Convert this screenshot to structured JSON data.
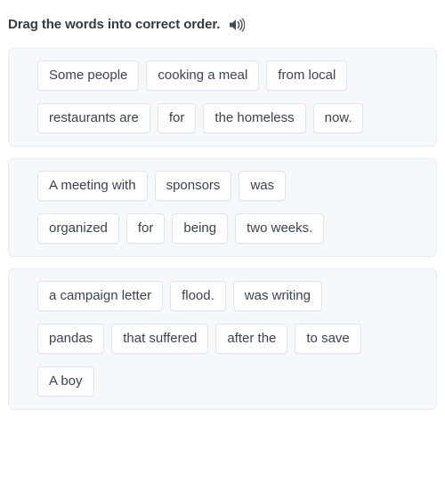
{
  "header": {
    "title": "Drag the words into correct order.",
    "audio_icon": "speaker-icon"
  },
  "colors": {
    "card_background": "#f5f9fc",
    "card_border": "#e7ecf1",
    "chip_background": "#ffffff",
    "chip_border": "#dfe5ea",
    "chip_text": "#3b4450",
    "title_text": "#333b45",
    "page_background": "#ffffff"
  },
  "exercises": [
    {
      "rows": [
        [
          "Some people",
          "cooking a meal",
          "from local"
        ],
        [
          "restaurants are",
          "for",
          "the homeless",
          "now."
        ]
      ]
    },
    {
      "rows": [
        [
          "A meeting with",
          "sponsors",
          "was"
        ],
        [
          "organized",
          "for",
          "being",
          "two weeks."
        ]
      ]
    },
    {
      "rows": [
        [
          "a campaign letter",
          "flood.",
          "was writing"
        ],
        [
          "pandas",
          "that suffered",
          "after the",
          "to save"
        ],
        [
          "A boy"
        ]
      ]
    }
  ]
}
